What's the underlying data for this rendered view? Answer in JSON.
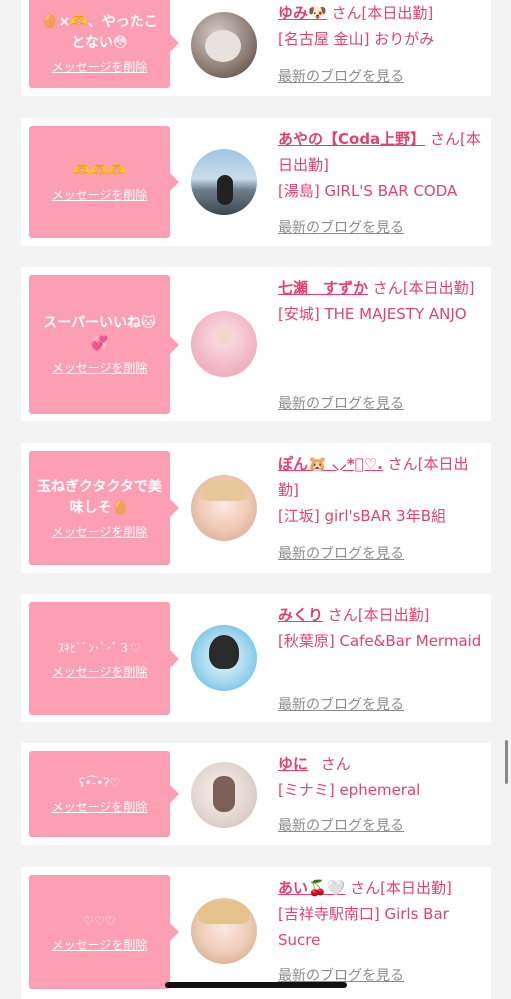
{
  "delete_label": "メッセージを削除",
  "blog_label": "最新のブログを見る",
  "san": "さん",
  "colors": {
    "accent": "#e0436d",
    "bubble": "#fd9fb3"
  },
  "cards": [
    {
      "message": "🥚×🫶、やったことない😳",
      "name": "ゆみ🐶",
      "status": "[本日出勤]",
      "shop": "[名古屋 金山] おりがみ",
      "avatar": "avatar-photo-1"
    },
    {
      "message": "🫶🫶🫶",
      "name": "あやの【Coda上野】",
      "status": "[本日出勤]",
      "shop": "[湯島] GIRL'S BAR CODA",
      "avatar": "avatar-photo-2"
    },
    {
      "message": "スーパーいいね🐱💞",
      "name": "七瀬　すずか",
      "status": "[本日出勤]",
      "shop": "[安城] THE MAJESTY ANJO",
      "avatar": "avatar-photo-3"
    },
    {
      "message": "玉ねぎクタクタで美味しそ🥚",
      "name": "ぽん🐹 ⸜⸝*ﾟ♡.",
      "status": "[本日出勤]",
      "shop": "[江坂] girl'sBAR 3年B組",
      "avatar": "avatar-photo-4"
    },
    {
      "message": "ｽｷﾋﾞﾞﾝ･ﾟ･ﾟ３♡",
      "name": "みくり",
      "status": "[本日出勤]",
      "shop": "[秋葉原] Cafe&Bar Mermaid",
      "avatar": "avatar-photo-5"
    },
    {
      "message": "ʕ•͡-•ʔ♡",
      "name": "ゆに",
      "status": "",
      "shop": "[ミナミ] ephemeral",
      "avatar": "avatar-photo-6"
    },
    {
      "message": "♡♡♡",
      "name": "あい🍒🤍",
      "status": "[本日出勤]",
      "shop": "[吉祥寺駅南口] Girls Bar Sucre",
      "avatar": "avatar-photo-7"
    }
  ]
}
